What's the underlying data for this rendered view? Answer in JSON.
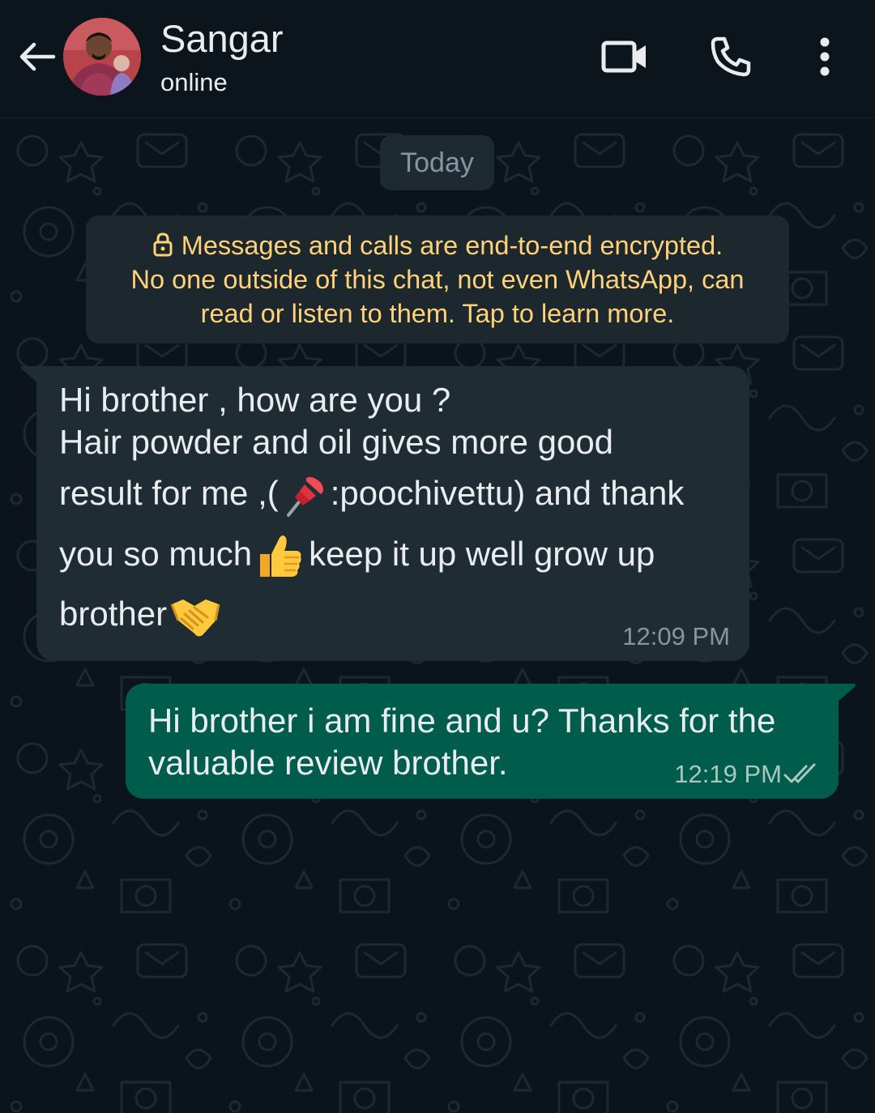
{
  "header": {
    "contact_name": "Sangar",
    "status": "online",
    "icons": [
      "back-arrow-icon",
      "video-call-icon",
      "voice-call-icon",
      "more-options-icon"
    ]
  },
  "chat": {
    "date_separator": "Today",
    "encryption_notice": {
      "line1": "Messages and calls are end-to-end encrypted.",
      "line2": "No one outside of this chat, not even WhatsApp, can",
      "line3": "read or listen to them. Tap to learn more."
    },
    "messages": [
      {
        "direction": "incoming",
        "lines": {
          "l1": "Hi brother , how are you ?",
          "l2": "Hair powder and oil gives more good",
          "l3a": "result for me ,(",
          "l3b": ":poochivettu) and thank",
          "l4a": "you so much",
          "l4b": "keep it up well grow up",
          "l5": "brother"
        },
        "emojis": [
          "📌",
          "👍",
          "🤝"
        ],
        "time": "12:09 PM"
      },
      {
        "direction": "outgoing",
        "lines": {
          "l1": "Hi brother  i am fine and u? Thanks for the",
          "l2": "valuable review brother."
        },
        "time": "12:19 PM",
        "status": "read"
      }
    ]
  },
  "colors": {
    "background": "#0b141a",
    "incoming_bubble": "#1f2c34",
    "outgoing_bubble": "#005c4b",
    "encryption_text": "#ffd279",
    "read_ticks": "#a9c7bf"
  }
}
